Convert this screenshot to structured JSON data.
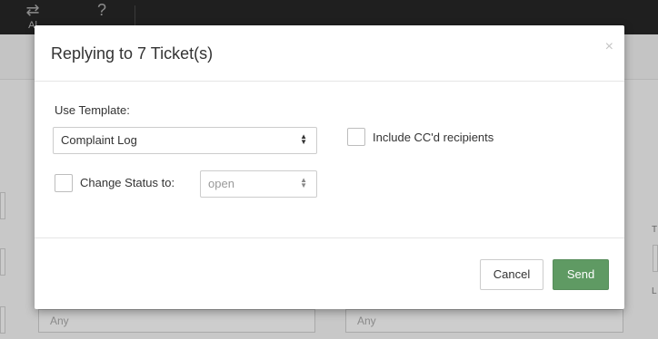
{
  "background": {
    "nav": [
      {
        "icon": "transfer-icon",
        "glyph": "⇄",
        "label": "Al"
      },
      {
        "icon": "help-icon",
        "glyph": "?",
        "label": ""
      }
    ],
    "fields": [
      "Any",
      "Any"
    ],
    "right_fragments": [
      "T",
      "L"
    ]
  },
  "modal": {
    "title": "Replying to 7 Ticket(s)",
    "close_glyph": "×",
    "template": {
      "label": "Use Template:",
      "selected": "Complaint Log"
    },
    "include_cc": {
      "label": "Include CC'd recipients",
      "checked": false
    },
    "change_status": {
      "label": "Change Status to:",
      "checked": false,
      "selected": "open"
    },
    "buttons": {
      "cancel": "Cancel",
      "send": "Send"
    }
  },
  "colors": {
    "send_button": "#5f9a63",
    "top_bar": "#1f1f1f"
  }
}
